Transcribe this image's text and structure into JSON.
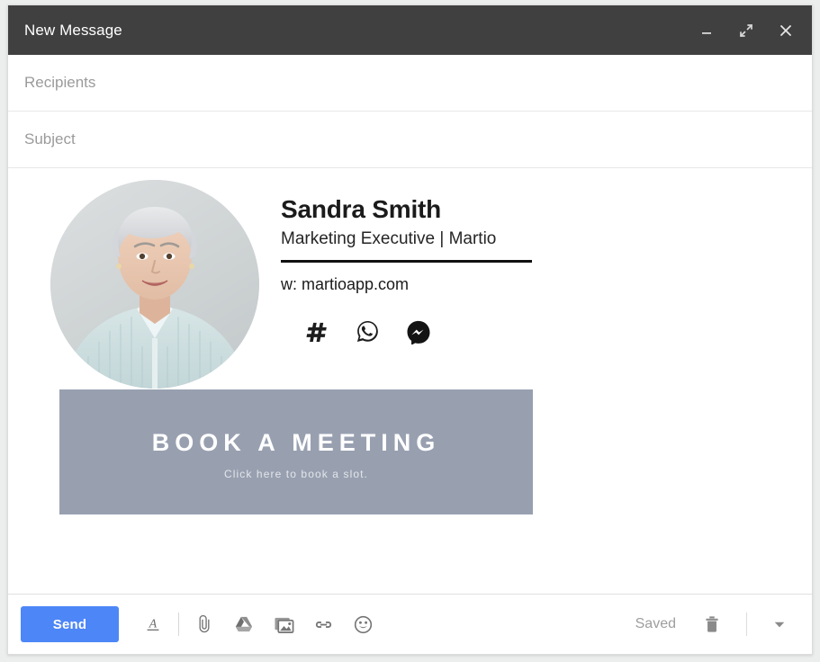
{
  "window": {
    "title": "New Message",
    "controls": [
      {
        "name": "minimize",
        "icon": "minimize-icon"
      },
      {
        "name": "expand",
        "icon": "expand-icon"
      },
      {
        "name": "close",
        "icon": "close-icon"
      }
    ]
  },
  "fields": {
    "recipients_placeholder": "Recipients",
    "recipients_value": "",
    "subject_placeholder": "Subject",
    "subject_value": ""
  },
  "signature": {
    "avatar_alt": "portrait-photo",
    "name": "Sandra Smith",
    "role": "Marketing Executive | Martio",
    "website": "w: martioapp.com",
    "socials": [
      {
        "label": "hashtag-icon"
      },
      {
        "label": "whatsapp-icon"
      },
      {
        "label": "messenger-icon"
      }
    ]
  },
  "banner": {
    "title": "BOOK A MEETING",
    "subtitle": "Click here to book a slot.",
    "background": "#98a0b0"
  },
  "toolbar": {
    "send_label": "Send",
    "send_color": "#4d86f7",
    "tools": [
      {
        "label": "formatting-options",
        "icon": "format-text-icon"
      },
      {
        "label": "attach-files",
        "icon": "paperclip-icon"
      },
      {
        "label": "insert-drive-file",
        "icon": "google-drive-icon"
      },
      {
        "label": "insert-photo",
        "icon": "photo-icon"
      },
      {
        "label": "insert-link",
        "icon": "link-icon"
      },
      {
        "label": "insert-emoji",
        "icon": "emoji-icon"
      }
    ],
    "status": "Saved",
    "discard_label": "discard-draft",
    "more_label": "more-options"
  }
}
